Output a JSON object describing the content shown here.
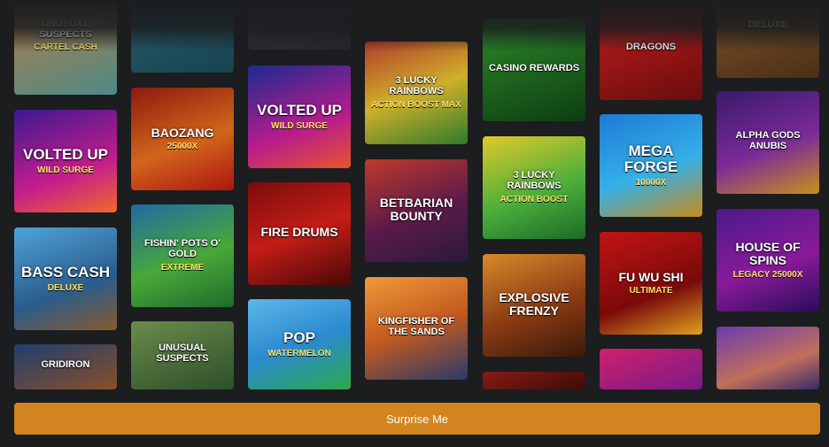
{
  "surprise_button": {
    "label": "Surprise Me",
    "color": "#d1841f"
  },
  "games": [
    {
      "name": "UNUSUAL SUSPECTS",
      "sub": "CARTEL CASH",
      "bg": "linear-gradient(160deg,#c97a3a,#4d8a86)",
      "size": "sm"
    },
    {
      "name": "VOLTED UP",
      "sub": "WILD SURGE",
      "bg": "linear-gradient(160deg,#3b1a8f,#c21c8e 60%,#f06a2a)",
      "size": "big"
    },
    {
      "name": "BASS CASH",
      "sub": "DELUXE",
      "bg": "linear-gradient(160deg,#4fa3d8,#2a5c8c 60%,#8a5a2b)",
      "size": "big"
    },
    {
      "name": "GRIDIRON",
      "sub": "",
      "bg": "linear-gradient(160deg,#1f3f6e,#8a4f2a)",
      "size": "sm"
    },
    {
      "name": "",
      "sub": "",
      "bg": "linear-gradient(160deg,#2b6a7a,#17424d)",
      "size": "sm"
    },
    {
      "name": "BAOZANG",
      "sub": "25000X",
      "bg": "linear-gradient(160deg,#8c1a0e,#d2651c 55%,#ad1610)",
      "size": "med"
    },
    {
      "name": "FISHIN' POTS O' GOLD",
      "sub": "EXTREME",
      "bg": "linear-gradient(160deg,#1f6ba3,#49a838 55%,#1f6b2d)",
      "size": "sm"
    },
    {
      "name": "UNUSUAL SUSPECTS",
      "sub": "",
      "bg": "linear-gradient(160deg,#6b8c4a,#2d4f2a)",
      "size": "sm"
    },
    {
      "name": "",
      "sub": "",
      "bg": "linear-gradient(160deg,#3a3f48,#24272d)",
      "size": "sm"
    },
    {
      "name": "VOLTED UP",
      "sub": "WILD SURGE",
      "bg": "linear-gradient(160deg,#1c2a8f,#b81c8e 60%,#e7552a)",
      "size": "big"
    },
    {
      "name": "FIRE DRUMS",
      "sub": "",
      "bg": "linear-gradient(160deg,#7a0d0d,#c41d16 50%,#4a0808)",
      "size": "med"
    },
    {
      "name": "POP",
      "sub": "WATERMELON",
      "bg": "linear-gradient(160deg,#5db7e8,#2b8ad0 50%,#2ca84a)",
      "size": "big"
    },
    {
      "name": "3 LUCKY RAINBOWS",
      "sub": "ACTION BOOST MAX",
      "bg": "linear-gradient(160deg,#b23b2b,#cfb02a 50%,#2f7a2a)",
      "size": "sm"
    },
    {
      "name": "BETBARIAN BOUNTY",
      "sub": "",
      "bg": "linear-gradient(160deg,#c0392b,#5a1a4a 55%,#2a1a3a)",
      "size": "med"
    },
    {
      "name": "KINGFISHER OF THE SANDS",
      "sub": "",
      "bg": "linear-gradient(160deg,#f19a3a,#c25a1f 50%,#2a3a6a)",
      "size": "sm"
    },
    {
      "name": "CASINO REWARDS",
      "sub": "",
      "bg": "linear-gradient(160deg,#2e8a2a,#0d3d12)",
      "size": "sm"
    },
    {
      "name": "3 LUCKY RAINBOWS",
      "sub": "ACTION BOOST",
      "bg": "linear-gradient(160deg,#e0c92a,#4caf3a 55%,#1b6b2a)",
      "size": "sm"
    },
    {
      "name": "EXPLOSIVE FRENZY",
      "sub": "",
      "bg": "linear-gradient(160deg,#d88a2a,#8a3a14 55%,#3a1a0a)",
      "size": "med"
    },
    {
      "name": "",
      "sub": "",
      "bg": "linear-gradient(160deg,#8a1a14,#3a0d0a)",
      "size": "sm"
    },
    {
      "name": "DRAGONS",
      "sub": "",
      "bg": "linear-gradient(160deg,#c81e1e,#6a0d0d)",
      "size": "sm"
    },
    {
      "name": "MEGA FORGE",
      "sub": "10000X",
      "bg": "linear-gradient(160deg,#1d7ad6,#35b0e8 55%,#c78a1a)",
      "size": "big"
    },
    {
      "name": "FU WU SHI",
      "sub": "ULTIMATE",
      "bg": "linear-gradient(160deg,#c21414,#7a0a0a 60%,#e0a020)",
      "size": "med"
    },
    {
      "name": "",
      "sub": "",
      "bg": "linear-gradient(160deg,#d0206a,#7a1a8a)",
      "size": "sm"
    },
    {
      "name": "DELUXE",
      "sub": "",
      "bg": "linear-gradient(160deg,#8a5a2a,#4a2f17)",
      "size": "sm"
    },
    {
      "name": "ALPHA GODS ANUBIS",
      "sub": "",
      "bg": "linear-gradient(160deg,#3a1a6a,#7a2a9a 55%,#c8901a)",
      "size": "sm"
    },
    {
      "name": "HOUSE OF SPINS",
      "sub": "LEGACY 25000X",
      "bg": "linear-gradient(160deg,#4a1a8a,#8a1a9a 55%,#2a0d5a)",
      "size": "med"
    },
    {
      "name": "",
      "sub": "",
      "bg": "linear-gradient(160deg,#6a3ab0,#c0705a 60%,#3a2a6a)",
      "size": "sm"
    }
  ]
}
